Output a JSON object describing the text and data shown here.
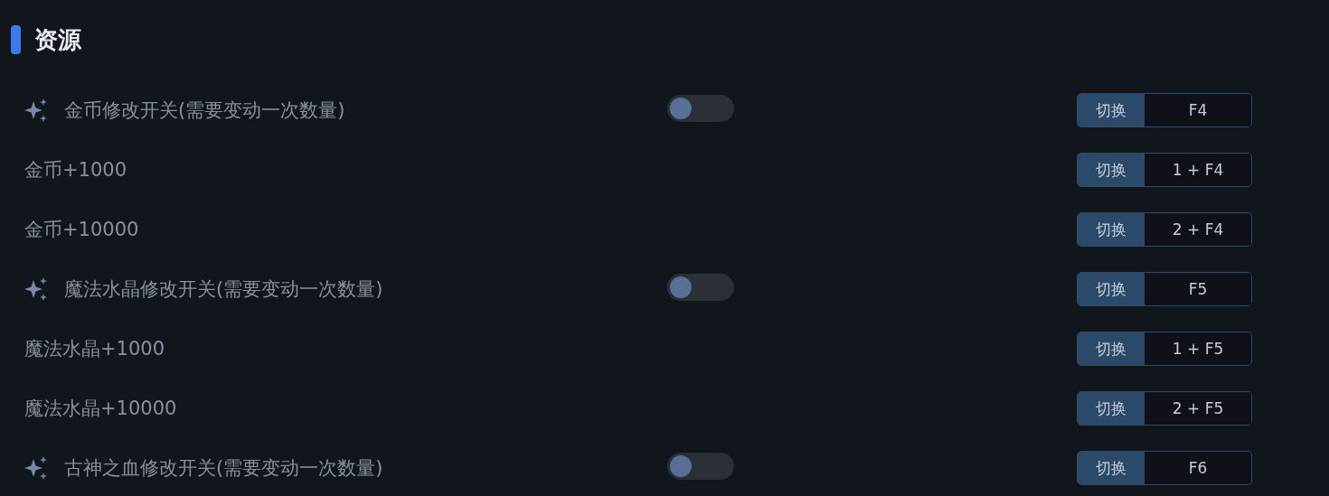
{
  "section": {
    "title": "资源"
  },
  "rows": [
    {
      "kind": "toggle",
      "label": "金币修改开关(需要变动一次数量)",
      "on": false,
      "action": "切换",
      "hotkey": "F4"
    },
    {
      "kind": "action",
      "label": "金币+1000",
      "action": "切换",
      "hotkey": "1 + F4"
    },
    {
      "kind": "action",
      "label": "金币+10000",
      "action": "切换",
      "hotkey": "2 + F4"
    },
    {
      "kind": "toggle",
      "label": "魔法水晶修改开关(需要变动一次数量)",
      "on": false,
      "action": "切换",
      "hotkey": "F5"
    },
    {
      "kind": "action",
      "label": "魔法水晶+1000",
      "action": "切换",
      "hotkey": "1 + F5"
    },
    {
      "kind": "action",
      "label": "魔法水晶+10000",
      "action": "切换",
      "hotkey": "2 + F5"
    },
    {
      "kind": "toggle",
      "label": "古神之血修改开关(需要变动一次数量)",
      "on": false,
      "action": "切换",
      "hotkey": "F6"
    }
  ]
}
